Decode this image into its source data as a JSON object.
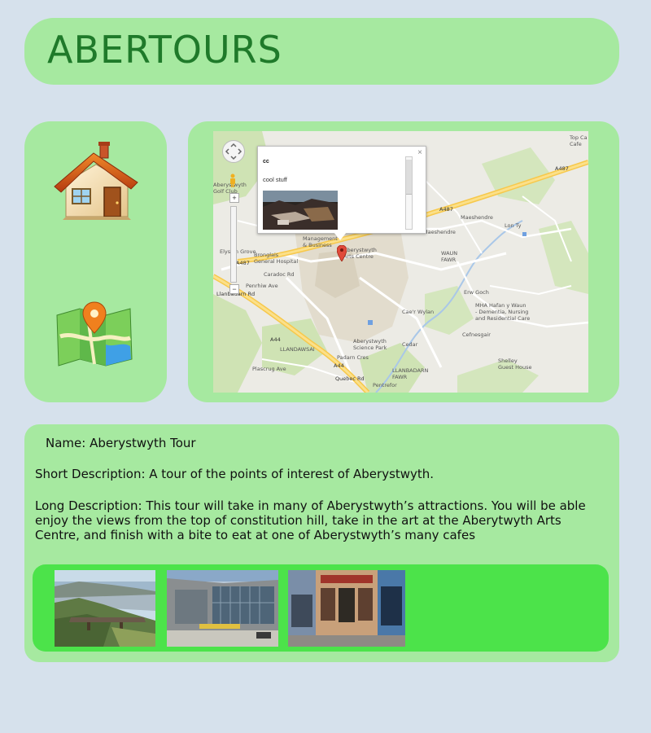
{
  "header": {
    "title": "ABERTOURS"
  },
  "nav": {
    "home_icon": "house-icon",
    "map_icon": "folded-map-pin-icon"
  },
  "map": {
    "info_window": {
      "title": "cc",
      "text": "cool stuff",
      "close_glyph": "×"
    },
    "labels": {
      "top_cafe": "Top Ca\nCafe",
      "golf": "Aberystwyth\nGolf Club",
      "mgmt": "Management\n& Business",
      "arts_centre": "Aberystwyth\nArts Centre",
      "bronglais": "Bronglais\nGeneral Hospital",
      "caradoc": "Caradoc Rd",
      "elysian": "Elysian Grove",
      "penrheidol": "Penrhiw Ave",
      "waun_fawr": "WAUN\nFAWR",
      "maeshendre": "Maeshendre",
      "maeshendre2": "Maeshendre",
      "lon_tyllwyd": "Lon Ty",
      "erw_goch": "Erw Goch",
      "mha": "MHA Hafan y Waun\n- Dementia, Nursing\nand Residential Care",
      "cefnesgair": "Cefnesgair",
      "science_park": "Aberystwyth\nScience Park",
      "llandawsai": "LLANDAWSAI",
      "padarn": "Padarn Cres",
      "llanbadarn": "LLANBADARN\nFAWR",
      "shelley": "Shelley\nGuest House",
      "plascrug": "Plascrug Ave",
      "cae_wylan": "Cae'r Wylan",
      "cedar": "Cedar",
      "pentre": "Pentrefor"
    },
    "road_labels": {
      "a487_top": "A487",
      "a487_mid": "A487",
      "a487_left": "A487",
      "a44_1": "A44",
      "a44_2": "A44",
      "llanbadarn_rd": "Llanbadarn Rd",
      "quebec": "Quebec Rd"
    }
  },
  "details": {
    "name": "Name: Aberystwyth Tour",
    "short_description": "Short Description: A tour of the points of interest of Aberystwyth.",
    "long_description": "Long Description: This tour will take in many of Aberystwyth’s attractions.  You will be able enjoy the views from the top of constitution hill, take in the art at the Aberytwyth Arts Centre, and finish with a bite to eat at one of Aberystwyth’s many cafes"
  },
  "gallery": {
    "images": [
      "constitution-hill-photo",
      "arts-centre-photo",
      "cafe-photo"
    ]
  }
}
